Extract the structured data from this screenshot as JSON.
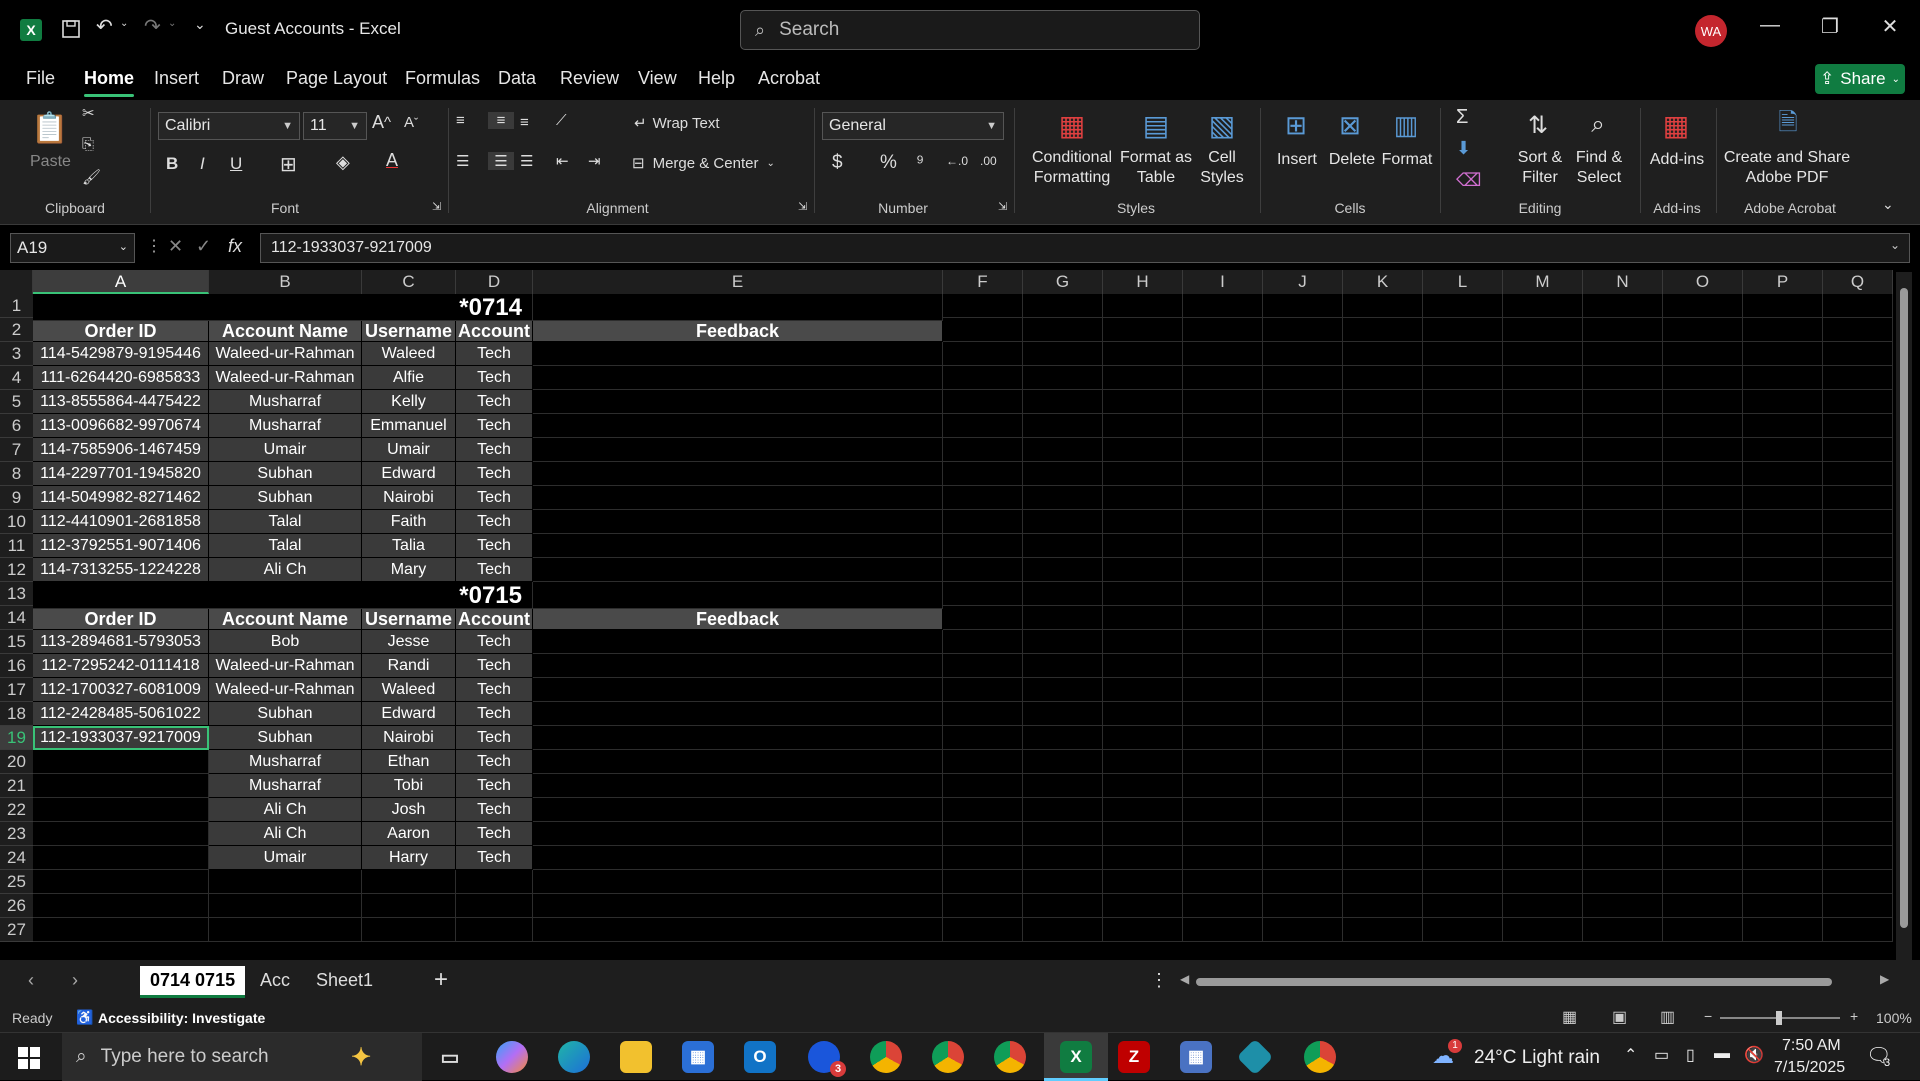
{
  "window": {
    "title": "Guest Accounts  -  Excel",
    "search_placeholder": "Search",
    "user_initials": "WA",
    "share_label": "Share"
  },
  "menu": [
    "File",
    "Home",
    "Insert",
    "Draw",
    "Page Layout",
    "Formulas",
    "Data",
    "Review",
    "View",
    "Help",
    "Acrobat"
  ],
  "active_menu": "Home",
  "ribbon": {
    "clipboard": {
      "label": "Clipboard",
      "paste": "Paste"
    },
    "font": {
      "label": "Font",
      "name": "Calibri",
      "size": "11",
      "bold": "B",
      "italic": "I",
      "underline": "U"
    },
    "alignment": {
      "label": "Alignment",
      "wrap": "Wrap Text",
      "merge": "Merge & Center"
    },
    "number": {
      "label": "Number",
      "format": "General"
    },
    "styles": {
      "label": "Styles",
      "cond1": "Conditional",
      "cond2": "Formatting",
      "fat1": "Format as",
      "fat2": "Table",
      "cs1": "Cell",
      "cs2": "Styles"
    },
    "cells": {
      "label": "Cells",
      "insert": "Insert",
      "delete": "Delete",
      "format": "Format"
    },
    "editing": {
      "label": "Editing",
      "sort1": "Sort &",
      "sort2": "Filter",
      "find1": "Find &",
      "find2": "Select"
    },
    "addins": {
      "label": "Add-ins",
      "button": "Add-ins"
    },
    "acrobat": {
      "label": "Adobe Acrobat",
      "b1": "Create and Share",
      "b2": "Adobe PDF"
    }
  },
  "formula_bar": {
    "name_box": "A19",
    "fx": "fx",
    "value": "112-1933037-9217009"
  },
  "columns": [
    "A",
    "B",
    "C",
    "D",
    "E",
    "F",
    "G",
    "H",
    "I",
    "J",
    "K",
    "L",
    "M",
    "N",
    "O",
    "P",
    "Q"
  ],
  "rows": [
    "1",
    "2",
    "3",
    "4",
    "5",
    "6",
    "7",
    "8",
    "9",
    "10",
    "11",
    "12",
    "13",
    "14",
    "15",
    "16",
    "17",
    "18",
    "19",
    "20",
    "21",
    "22",
    "23",
    "24",
    "25",
    "26",
    "27"
  ],
  "sheet": {
    "block1_title": "*0714",
    "block2_title": "*0715",
    "headers": {
      "order": "Order ID",
      "account_name": "Account Name",
      "username": "Username",
      "account": "Account",
      "feedback": "Feedback"
    },
    "block1": [
      [
        "114-5429879-9195446",
        "Waleed-ur-Rahman",
        "Waleed",
        "Tech"
      ],
      [
        "111-6264420-6985833",
        "Waleed-ur-Rahman",
        "Alfie",
        "Tech"
      ],
      [
        "113-8555864-4475422",
        "Musharraf",
        "Kelly",
        "Tech"
      ],
      [
        "113-0096682-9970674",
        "Musharraf",
        "Emmanuel",
        "Tech"
      ],
      [
        "114-7585906-1467459",
        "Umair",
        "Umair",
        "Tech"
      ],
      [
        "114-2297701-1945820",
        "Subhan",
        "Edward",
        "Tech"
      ],
      [
        "114-5049982-8271462",
        "Subhan",
        "Nairobi",
        "Tech"
      ],
      [
        "112-4410901-2681858",
        "Talal",
        "Faith",
        "Tech"
      ],
      [
        "112-3792551-9071406",
        "Talal",
        "Talia",
        "Tech"
      ],
      [
        "114-7313255-1224228",
        "Ali Ch",
        "Mary",
        "Tech"
      ]
    ],
    "block2": [
      [
        "113-2894681-5793053",
        "Bob",
        "Jesse",
        "Tech"
      ],
      [
        "112-7295242-0111418",
        "Waleed-ur-Rahman",
        "Randi",
        "Tech"
      ],
      [
        "112-1700327-6081009",
        "Waleed-ur-Rahman",
        "Waleed",
        "Tech"
      ],
      [
        "112-2428485-5061022",
        "Subhan",
        "Edward",
        "Tech"
      ],
      [
        "112-1933037-9217009",
        "Subhan",
        "Nairobi",
        "Tech"
      ],
      [
        "",
        "Musharraf",
        "Ethan",
        "Tech"
      ],
      [
        "",
        "Musharraf",
        "Tobi",
        "Tech"
      ],
      [
        "",
        "Ali Ch",
        "Josh",
        "Tech"
      ],
      [
        "",
        "Ali Ch",
        "Aaron",
        "Tech"
      ],
      [
        "",
        "Umair",
        "Harry",
        "Tech"
      ]
    ]
  },
  "tabs": [
    "0714 0715",
    "Acc",
    "Sheet1"
  ],
  "status": {
    "ready": "Ready",
    "accessibility": "Accessibility: Investigate",
    "zoom": "100%"
  },
  "taskbar": {
    "search": "Type here to search",
    "weather": "24°C  Light rain",
    "time": "7:50 AM",
    "date": "7/15/2025",
    "notif_count": "3",
    "weather_badge": "1",
    "outlook_badge": "3"
  },
  "colors": {
    "accent": "#107c41",
    "ribbon_bg": "#1f1f1f",
    "cell_gray": "#3a3a3a",
    "header_gray": "#4a4a4a"
  }
}
